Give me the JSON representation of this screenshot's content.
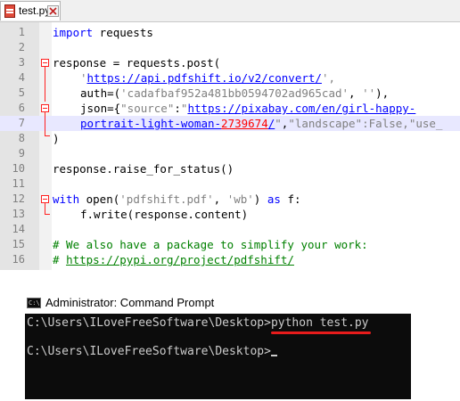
{
  "editor": {
    "tab": {
      "label": "test.py",
      "close_icon": "close-icon",
      "file_icon": "python-file-icon"
    },
    "line_numbers": [
      "1",
      "2",
      "3",
      "4",
      "5",
      "6",
      "7",
      "8",
      "9",
      "10",
      "11",
      "12",
      "13",
      "14",
      "15",
      "16"
    ],
    "lines": {
      "l1": {
        "kw": "import",
        "rest": " requests"
      },
      "l3": {
        "a": "response = requests.post("
      },
      "l4": {
        "q1": "'",
        "url": "https://api.pdfshift.io/v2/convert/",
        "q2": "',",
        "tail": ""
      },
      "l5": {
        "a": "auth=(",
        "s1": "'cadafbaf952a481bb0594702ad965cad'",
        "b": ", ",
        "s2": "''",
        "c": "),"
      },
      "l6": {
        "a": "json={",
        "s1": "\"source\"",
        "b": ":",
        "s2a": "\"",
        "url": "https://pixabay.com/en/girl-happy-"
      },
      "l7": {
        "url": "portrait-light-woman-",
        "num": "2739674",
        "url2": "/",
        "s1": "\"",
        "b": ",",
        "s2": "\"landscape\"",
        "c": ":False,",
        "s3": "\"use_"
      },
      "l8": {
        "a": ")"
      },
      "l10": {
        "a": "response.raise_for_status()"
      },
      "l12": {
        "kw": "with",
        "a": " open(",
        "s1": "'pdfshift.pdf'",
        "b": ", ",
        "s2": "'wb'",
        "c": ") ",
        "kw2": "as",
        "d": " f:"
      },
      "l13": {
        "a": "f.write(response.content)"
      },
      "l15": {
        "cm": "# We also have a package to simplify your work:"
      },
      "l16": {
        "cm": "# ",
        "url": "https://pypi.org/project/pdfshift/"
      }
    }
  },
  "cmd": {
    "title": "Administrator: Command Prompt",
    "icon": "command-prompt-icon",
    "icon_text": "C:\\",
    "prompt1": "C:\\Users\\ILoveFreeSoftware\\Desktop>",
    "command1": "python test.py",
    "prompt2": "C:\\Users\\ILoveFreeSoftware\\Desktop>"
  },
  "colors": {
    "keyword": "#0000ff",
    "string": "#808080",
    "number": "#ff0000",
    "comment": "#008000",
    "active_line": "#e8e8ff",
    "underline": "#e81c1c"
  }
}
